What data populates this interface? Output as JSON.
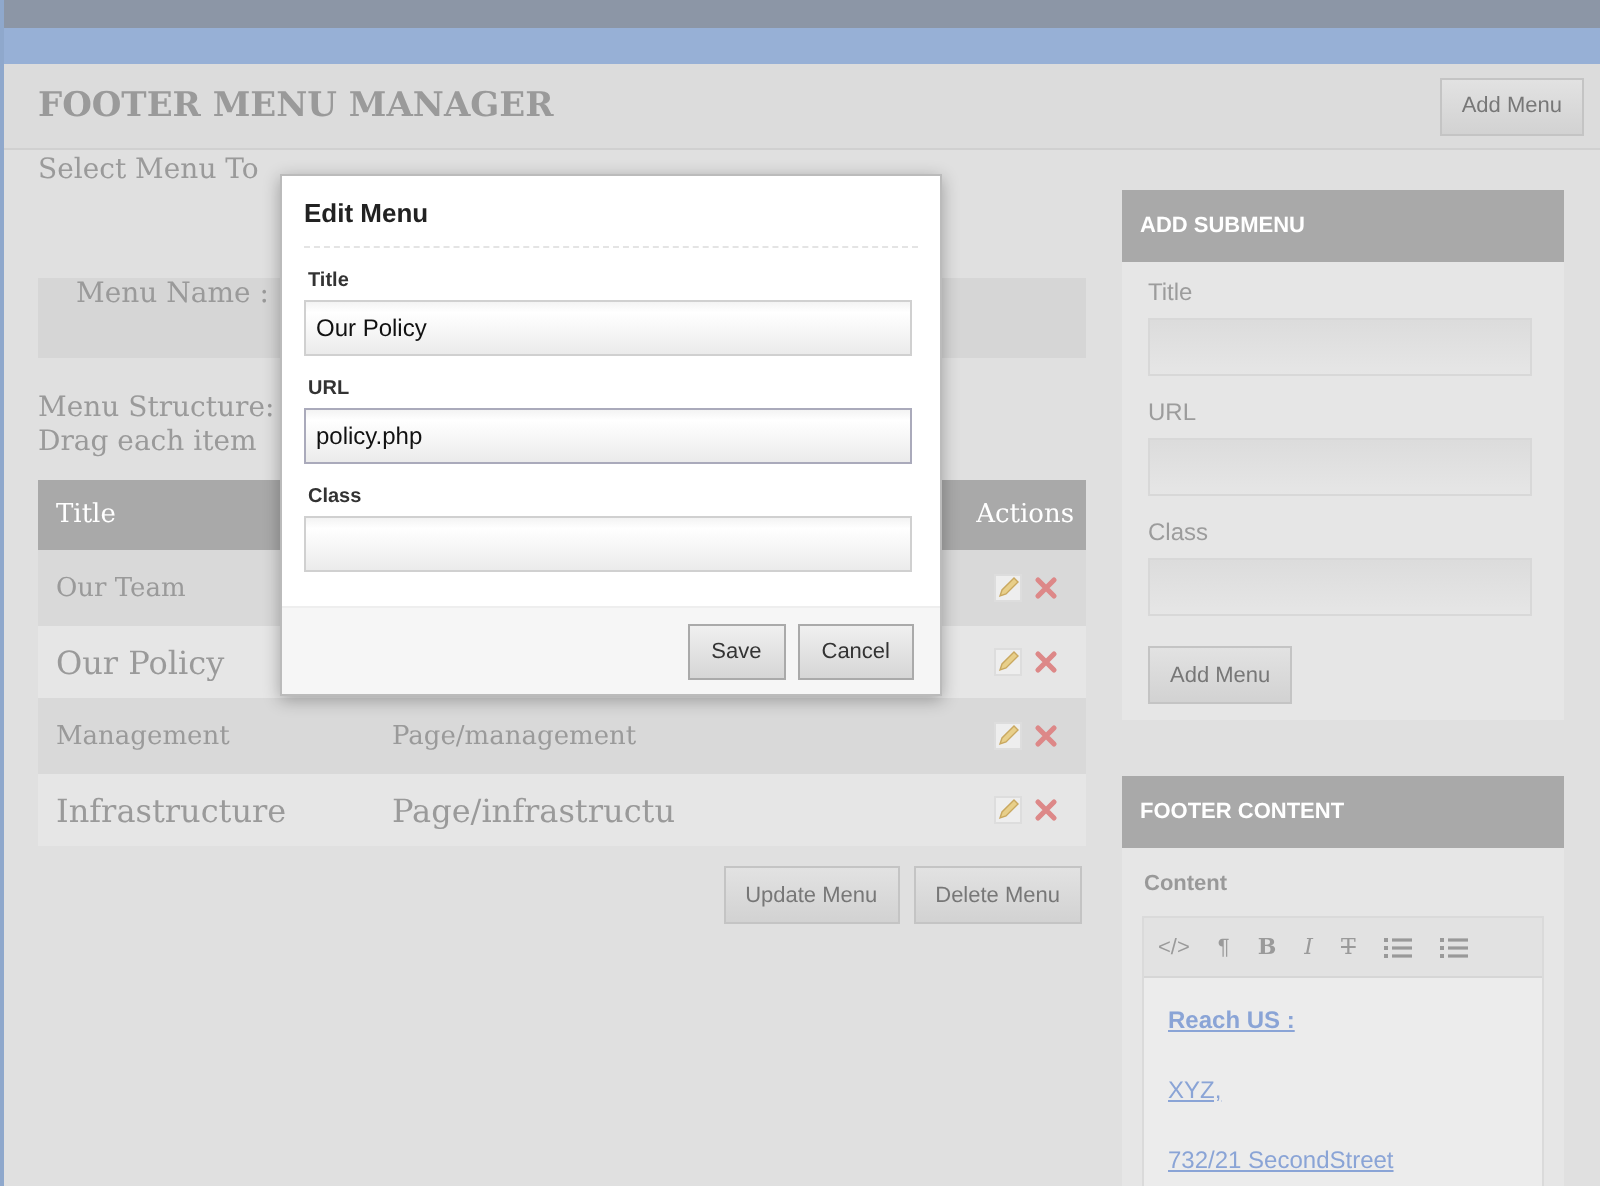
{
  "header": {
    "title": "FOOTER MENU MANAGER",
    "button": "Add Menu"
  },
  "select_label": "Select Menu To",
  "menu_name_label": "Menu Name :",
  "structure_lines": [
    "Menu Structure:",
    "Drag each item"
  ],
  "table": {
    "columns": [
      "Title",
      "Actions"
    ],
    "rows": [
      {
        "title": "Our Team"
      },
      {
        "title": "Our Policy"
      },
      {
        "title": "Management",
        "link": "Page/management"
      },
      {
        "title": "Infrastructure",
        "link": "Page/infrastructu"
      }
    ]
  },
  "table_buttons": [
    "Update Menu",
    "Delete Menu"
  ],
  "add_submenu": {
    "heading": "ADD SUBMENU",
    "fields": [
      "Title",
      "URL",
      "Class"
    ],
    "button": "Add Menu"
  },
  "footer_content": {
    "heading": "FOOTER CONTENT",
    "label": "Content",
    "toolbar": [
      {
        "kind": "glyph",
        "label": "</>"
      },
      {
        "kind": "glyph",
        "label": "¶"
      },
      {
        "kind": "glyph",
        "label": "B"
      },
      {
        "kind": "glyph",
        "label": "I"
      },
      {
        "kind": "glyph",
        "label": "T"
      },
      {
        "kind": "bullet-list"
      },
      {
        "kind": "numbered-list"
      }
    ],
    "lines": [
      "Reach US :",
      "XYZ,",
      "732/21 SecondStreet"
    ]
  },
  "modal": {
    "title": "Edit Menu",
    "fields": [
      {
        "label": "Title",
        "value": "Our Policy",
        "focused": false
      },
      {
        "label": "URL",
        "value": "policy.php",
        "focused": true
      },
      {
        "label": "Class",
        "focused": false
      }
    ],
    "buttons": [
      "Save",
      "Cancel"
    ]
  }
}
